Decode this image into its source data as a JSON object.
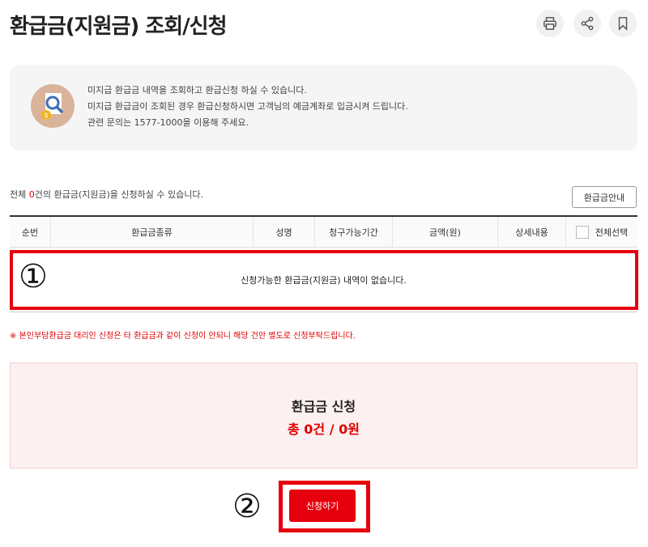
{
  "header": {
    "title": "환급금(지원금) 조회/신청"
  },
  "tools": {
    "print_icon": "printer-icon",
    "share_icon": "share-icon",
    "bookmark_icon": "bookmark-icon"
  },
  "info": {
    "icon": "search-money-icon",
    "lines": [
      "미지급 환급금 내역을 조회하고 환급신청 하실 수 있습니다.",
      "미지급 환급금이 조회된 경우 환급신청하시면 고객님의 예금계좌로 입금시켜 드립니다.",
      "관련 문의는 1577-1000을 이용해 주세요."
    ]
  },
  "summary": {
    "prefix": "전체 ",
    "count": "0",
    "suffix": "건의 환급금(지원금)을 신청하실 수 있습니다."
  },
  "guide_button": "환급금안내",
  "table": {
    "columns": [
      "순번",
      "환급금종류",
      "성명",
      "청구가능기간",
      "금액(원)",
      "상세내용",
      "전체선택"
    ],
    "empty_message": "신청가능한 환급금(지원금) 내역이 없습니다."
  },
  "notice": "※ 본인부담환급금 대리인 신청은 타 환급금과 같이 신청이 안되니 해당 건만 별도로 신청부탁드립니다.",
  "apply": {
    "title": "환급금 신청",
    "total": "총 0건 / 0원",
    "button": "신청하기"
  },
  "annotations": {
    "marker1": "①",
    "marker2": "②"
  },
  "colors": {
    "accent": "#e6000e",
    "info_bg": "#f5f5f5",
    "apply_bg": "#fdf0f0"
  }
}
